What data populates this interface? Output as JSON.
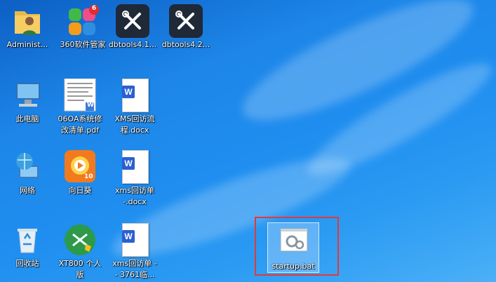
{
  "desktop": {
    "icons": [
      {
        "label": "Administ..."
      },
      {
        "label": "360软件管家",
        "badge": "6"
      },
      {
        "label": "dbtools4.1..."
      },
      {
        "label": "dbtools4.2..."
      },
      {
        "label": "此电脑"
      },
      {
        "label": "06OA系统修\n改清单.pdf"
      },
      {
        "label": "XMS回访流\n程.docx"
      },
      {
        "label": "网络"
      },
      {
        "label": "向日葵"
      },
      {
        "label": "xms回访单\n-.docx"
      },
      {
        "label": "回收站"
      },
      {
        "label": "XT800 个人\n版"
      },
      {
        "label": "xms回访单 -\n- 3761临..."
      },
      {
        "label": "startup.bat"
      }
    ],
    "sunflower_badge": "10",
    "word_tag": "W"
  },
  "colors": {
    "highlight_border": "#e53935",
    "desktop_blue": "#1d86e8"
  }
}
